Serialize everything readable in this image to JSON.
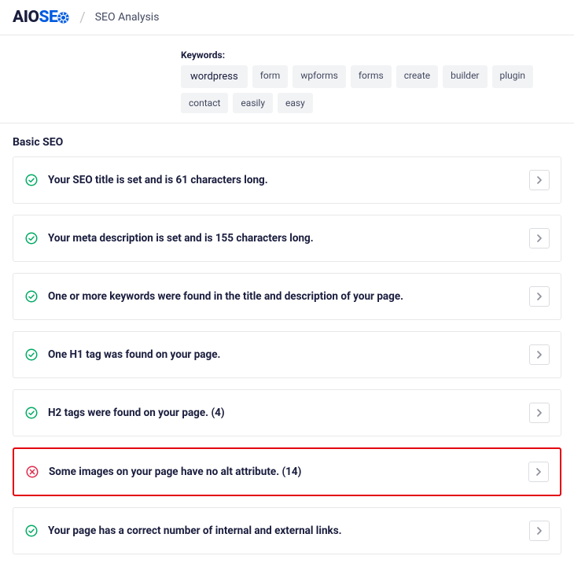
{
  "header": {
    "logo_aio": "AIO",
    "logo_seo": "SE",
    "title": "SEO Analysis"
  },
  "keywords": {
    "label": "Keywords:",
    "primary": "wordpress",
    "tags": [
      "form",
      "wpforms",
      "forms",
      "create",
      "builder",
      "plugin",
      "contact",
      "easily",
      "easy"
    ]
  },
  "section": {
    "title": "Basic SEO",
    "items": [
      {
        "status": "ok",
        "text": "Your SEO title is set and is 61 characters long.",
        "highlight": false
      },
      {
        "status": "ok",
        "text": "Your meta description is set and is 155 characters long.",
        "highlight": false
      },
      {
        "status": "ok",
        "text": "One or more keywords were found in the title and description of your page.",
        "highlight": false
      },
      {
        "status": "ok",
        "text": "One H1 tag was found on your page.",
        "highlight": false
      },
      {
        "status": "ok",
        "text": "H2 tags were found on your page. (4)",
        "highlight": false
      },
      {
        "status": "error",
        "text": "Some images on your page have no alt attribute. (14)",
        "highlight": true
      },
      {
        "status": "ok",
        "text": "Your page has a correct number of internal and external links.",
        "highlight": false
      }
    ]
  },
  "colors": {
    "ok": "#00aa63",
    "error": "#df2a4a"
  }
}
